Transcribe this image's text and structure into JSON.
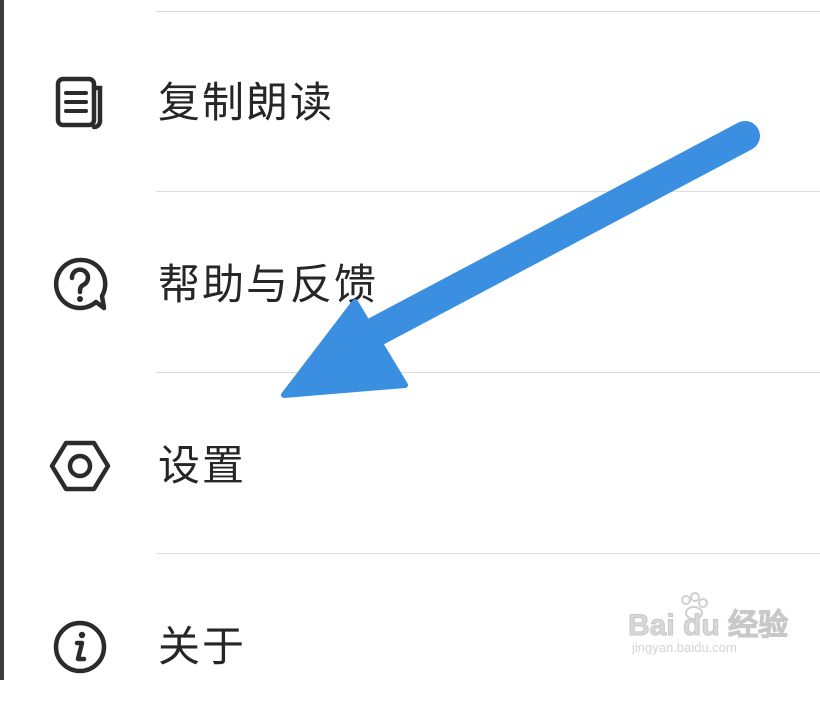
{
  "menu": {
    "items": [
      {
        "label": "复制朗读",
        "icon": "document-copy-icon"
      },
      {
        "label": "帮助与反馈",
        "icon": "help-feedback-icon"
      },
      {
        "label": "设置",
        "icon": "settings-hexagon-icon"
      },
      {
        "label": "关于",
        "icon": "info-icon"
      }
    ]
  },
  "annotation": {
    "arrow_color": "#3a8fe0"
  },
  "watermark": {
    "logo_text": "Bai du 经验",
    "url_text": "jingyan.baidu.com"
  },
  "colors": {
    "text": "#262626",
    "icon": "#2b2b2b",
    "divider": "#dedede"
  }
}
